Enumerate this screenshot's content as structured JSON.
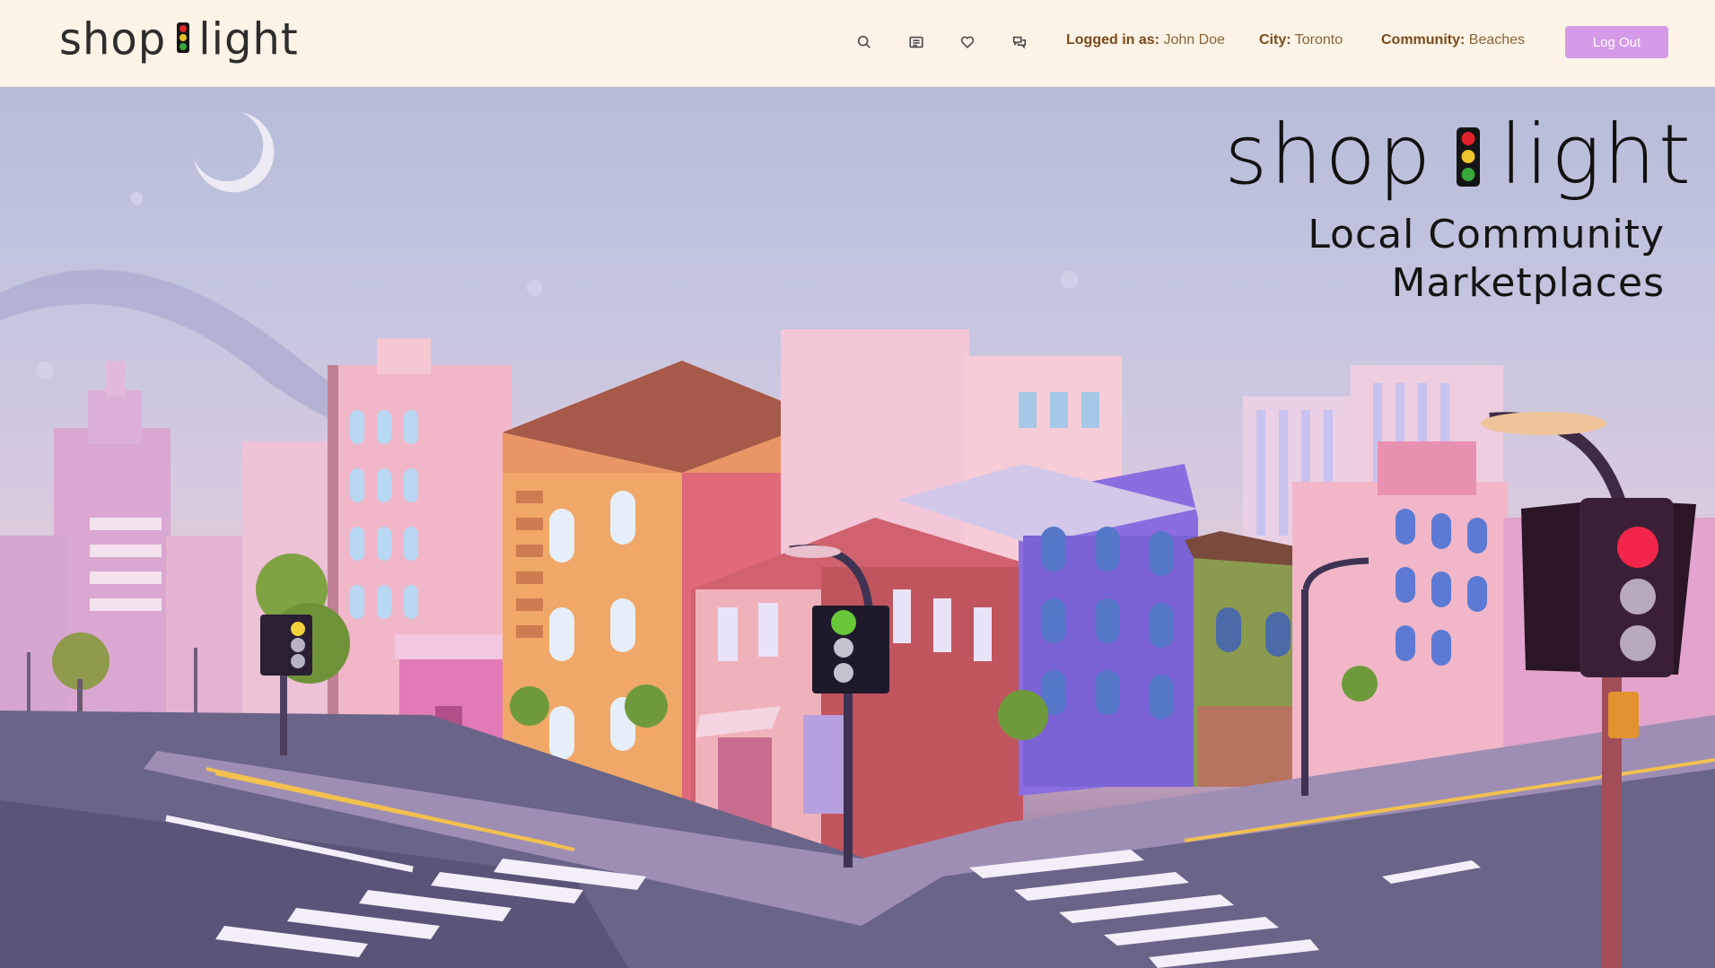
{
  "header": {
    "logo_left": "shop",
    "logo_right": "light",
    "nav_icons": [
      "search-icon",
      "list-icon",
      "heart-icon",
      "chat-icon"
    ],
    "logged_in_label": "Logged in as:",
    "logged_in_value": "John Doe",
    "city_label": "City:",
    "city_value": "Toronto",
    "community_label": "Community:",
    "community_value": "Beaches",
    "logout_label": "Log Out"
  },
  "hero": {
    "logo_left": "shop",
    "logo_right": "light",
    "tagline_line1": "Local Community",
    "tagline_line2": "Marketplaces"
  },
  "colors": {
    "header_bg": "#fdf3e6",
    "logout_button": "#d59be8",
    "label_brown": "#7a4a1c"
  }
}
